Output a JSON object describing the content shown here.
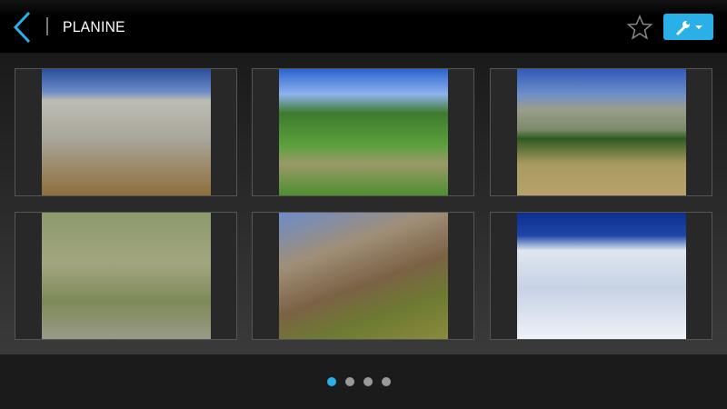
{
  "header": {
    "title": "PLANINE"
  },
  "gallery": {
    "items": [
      {
        "name": "rocky-plateau-signpost"
      },
      {
        "name": "green-valley-stream"
      },
      {
        "name": "hikers-meadow"
      },
      {
        "name": "horse-pasture"
      },
      {
        "name": "rock-peak"
      },
      {
        "name": "snowy-mountain"
      }
    ]
  },
  "pagination": {
    "pages": 4,
    "current": 1
  },
  "colors": {
    "accent": "#29b0e8"
  }
}
